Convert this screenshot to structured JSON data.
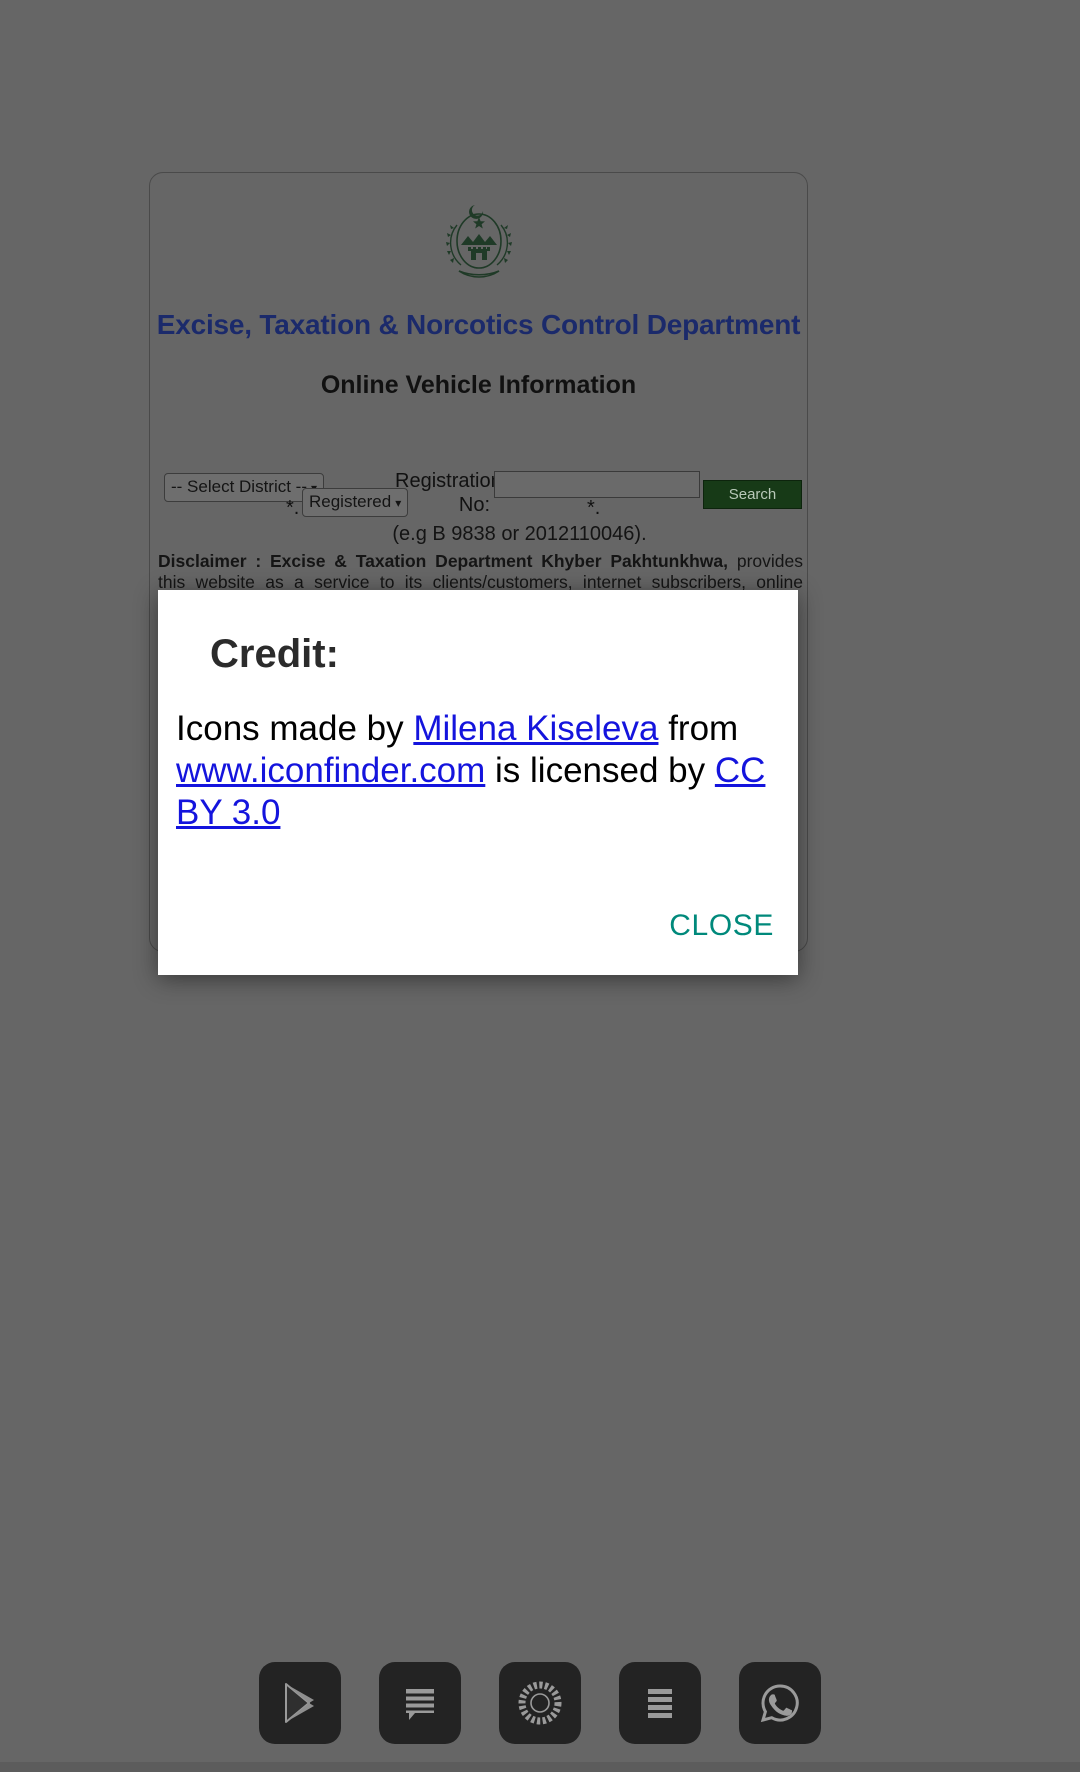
{
  "page": {
    "emblem_alt": "government-emblem",
    "title": "Excise, Taxation & Norcotics Control Department",
    "subtitle": "Online Vehicle Information"
  },
  "form": {
    "district_select": {
      "value": "-- Select District --",
      "required_marker": "*."
    },
    "registration_type_select": {
      "value": "Registered"
    },
    "registration_no": {
      "label": "Registration No:",
      "value": "",
      "placeholder": "",
      "required_marker": "*."
    },
    "search_label": "Search",
    "example_hint": "(e.g B 9838 or 2012110046)."
  },
  "disclaimer": {
    "heading": "Disclaimer :  Excise & Taxation Department Khyber Pakhtunkhwa,",
    "body": "provides this website as a service to its clients/customers, internet subscribers, online readers and"
  },
  "dialog": {
    "title": "Credit:",
    "text_before_author": "Icons made by ",
    "author_link": "Milena Kiseleva",
    "text_after_author": " from ",
    "source_link": "www.iconfinder.com",
    "text_license": " is licensed by ",
    "license_link": "CC BY 3.0",
    "close_label": "CLOSE"
  },
  "dock": {
    "items": [
      {
        "icon": "play-store-icon",
        "label": "Play Store"
      },
      {
        "icon": "chat-bubble-icon",
        "label": "Messages"
      },
      {
        "icon": "camera-ring-icon",
        "label": "Camera"
      },
      {
        "icon": "list-lines-icon",
        "label": "List"
      },
      {
        "icon": "whatsapp-icon",
        "label": "WhatsApp"
      }
    ]
  },
  "colors": {
    "backdrop": "#666666",
    "title_blue": "#1b2a6b",
    "search_green": "#173a17",
    "link_blue": "#1414dd",
    "close_teal": "#00897b",
    "dialog_bg": "#ffffff",
    "dock_tile": "#232323"
  }
}
